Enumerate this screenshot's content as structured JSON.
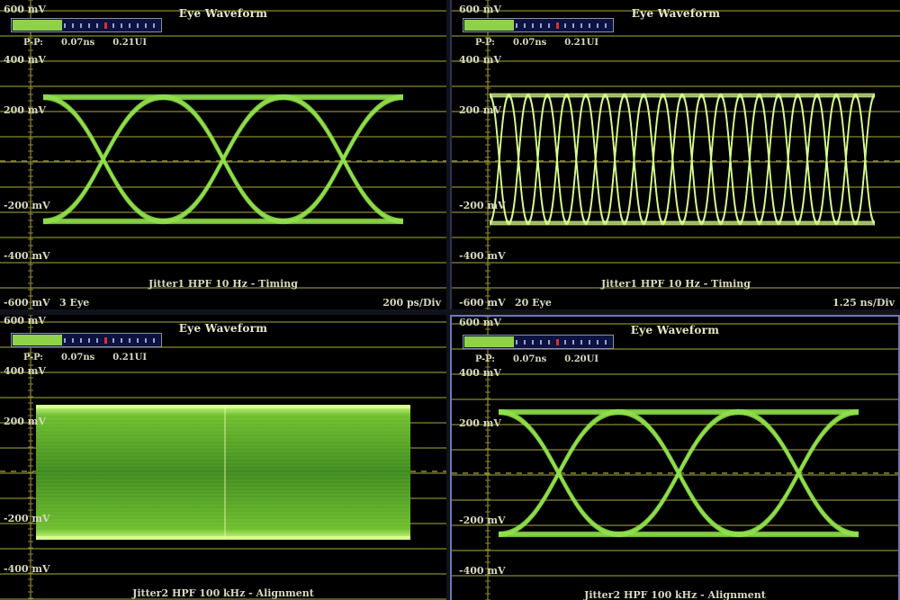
{
  "panels": [
    {
      "title": "Eye Waveform",
      "pp_label": "P-P:",
      "pp_time": "0.07ns",
      "pp_ui": "0.21UI",
      "y_labels": [
        "600 mV",
        "400 mV",
        "200 mV",
        "-200 mV",
        "-400 mV",
        "-600 mV"
      ],
      "footer": "Jitter1 HPF 10 Hz - Timing",
      "eye_count": "3 Eye",
      "time_div": "200 ps/Div",
      "meter_fill": 0.33,
      "marker_pos": 0.62
    },
    {
      "title": "Eye Waveform",
      "pp_label": "P-P:",
      "pp_time": "0.07ns",
      "pp_ui": "0.21UI",
      "y_labels": [
        "600 mV",
        "400 mV",
        "200 mV",
        "-200 mV",
        "-400 mV",
        "-600 mV"
      ],
      "footer": "Jitter1 HPF 10 Hz - Timing",
      "eye_count": "20 Eye",
      "time_div": "1.25 ns/Div",
      "meter_fill": 0.33,
      "marker_pos": 0.62
    },
    {
      "title": "Eye Waveform",
      "pp_label": "P-P:",
      "pp_time": "0.07ns",
      "pp_ui": "0.21UI",
      "y_labels": [
        "600 mV",
        "400 mV",
        "200 mV",
        "-200 mV",
        "-400 mV"
      ],
      "footer": "Jitter2 HPF 100 kHz - Alignment",
      "meter_fill": 0.33,
      "marker_pos": 0.62
    },
    {
      "title": "Eye Waveform",
      "pp_label": "P-P:",
      "pp_time": "0.07ns",
      "pp_ui": "0.20UI",
      "y_labels": [
        "600 mV",
        "400 mV",
        "200 mV",
        "-200 mV",
        "-400 mV"
      ],
      "footer": "Jitter2 HPF 100 kHz - Alignment",
      "meter_fill": 0.33,
      "marker_pos": 0.62
    }
  ],
  "colors": {
    "trace": "#8fe04a",
    "trace_bright": "#d8ff90",
    "grid": "#8a8a30",
    "meter_bg": "#0c1340",
    "marker": "#d83030"
  }
}
